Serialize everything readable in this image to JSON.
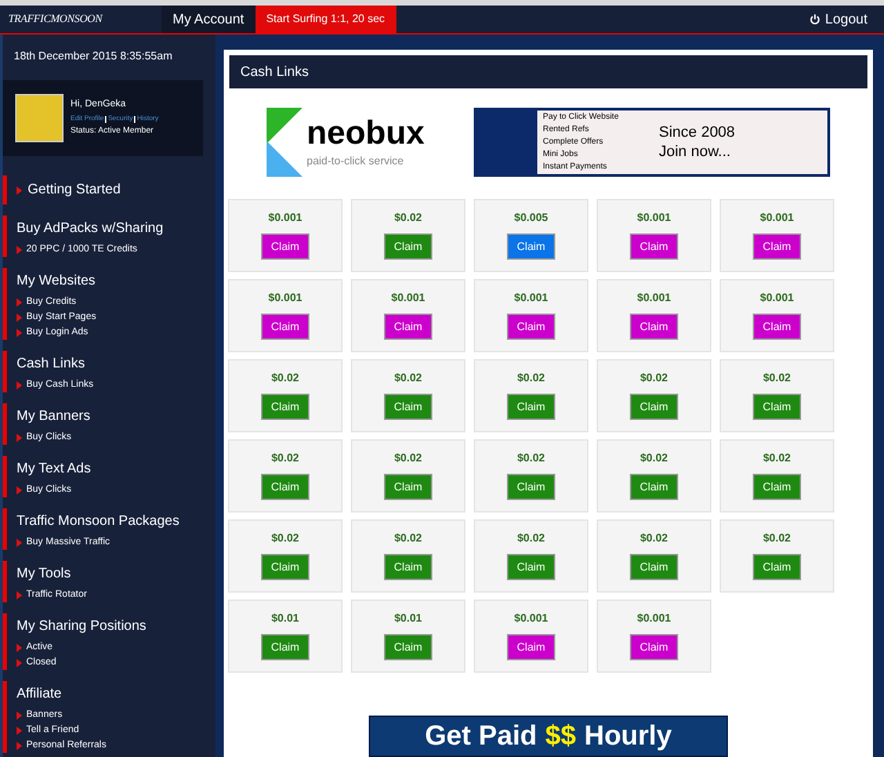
{
  "topbar": {
    "logo": "TRAFFICMONSOON",
    "tabs": [
      {
        "label": "My Account",
        "kind": "plain"
      },
      {
        "label": "Start Surfing 1:1, 20 sec",
        "kind": "alert"
      }
    ],
    "logout": "Logout"
  },
  "sidebar": {
    "datetime": "18th December 2015 8:35:55am",
    "profile": {
      "greeting": "Hi, DenGeka",
      "links": [
        "Edit Profile",
        "Security",
        "History"
      ],
      "status": "Status: Active Member"
    },
    "sections": [
      {
        "kind": "link",
        "title": "Getting Started"
      },
      {
        "kind": "group",
        "title": "Buy AdPacks w/Sharing",
        "links": [
          "20 PPC / 1000 TE Credits"
        ]
      },
      {
        "kind": "group",
        "title": "My Websites",
        "links": [
          "Buy Credits",
          "Buy Start Pages",
          "Buy Login Ads"
        ]
      },
      {
        "kind": "group",
        "title": "Cash Links",
        "links": [
          "Buy Cash Links"
        ]
      },
      {
        "kind": "group",
        "title": "My Banners",
        "links": [
          "Buy Clicks"
        ]
      },
      {
        "kind": "group",
        "title": "My Text Ads",
        "links": [
          "Buy Clicks"
        ]
      },
      {
        "kind": "group",
        "title": "Traffic Monsoon Packages",
        "links": [
          "Buy Massive Traffic"
        ]
      },
      {
        "kind": "group",
        "title": "My Tools",
        "links": [
          "Traffic Rotator"
        ]
      },
      {
        "kind": "group",
        "title": "My Sharing Positions",
        "links": [
          "Active",
          "Closed"
        ]
      },
      {
        "kind": "group",
        "title": "Affiliate",
        "links": [
          "Banners",
          "Tell a Friend",
          "Personal Referrals"
        ]
      }
    ]
  },
  "main": {
    "title": "Cash Links",
    "ad": {
      "brand": "neobux",
      "tagline": "paid-to-click service",
      "features": [
        "Pay to Click Website",
        "Rented Refs",
        "Complete Offers",
        "Mini Jobs",
        "Instant Payments"
      ],
      "slogan": [
        "Since 2008",
        "Join now..."
      ]
    },
    "cards": [
      {
        "amount": "$0.001",
        "button": "Claim",
        "color": "#cc00cc"
      },
      {
        "amount": "$0.02",
        "button": "Claim",
        "color": "#1f8a12"
      },
      {
        "amount": "$0.005",
        "button": "Claim",
        "color": "#0a74e8"
      },
      {
        "amount": "$0.001",
        "button": "Claim",
        "color": "#cc00cc"
      },
      {
        "amount": "$0.001",
        "button": "Claim",
        "color": "#cc00cc"
      },
      {
        "amount": "$0.001",
        "button": "Claim",
        "color": "#cc00cc"
      },
      {
        "amount": "$0.001",
        "button": "Claim",
        "color": "#cc00cc"
      },
      {
        "amount": "$0.001",
        "button": "Claim",
        "color": "#cc00cc"
      },
      {
        "amount": "$0.001",
        "button": "Claim",
        "color": "#cc00cc"
      },
      {
        "amount": "$0.001",
        "button": "Claim",
        "color": "#cc00cc"
      },
      {
        "amount": "$0.02",
        "button": "Claim",
        "color": "#1f8a12"
      },
      {
        "amount": "$0.02",
        "button": "Claim",
        "color": "#1f8a12"
      },
      {
        "amount": "$0.02",
        "button": "Claim",
        "color": "#1f8a12"
      },
      {
        "amount": "$0.02",
        "button": "Claim",
        "color": "#1f8a12"
      },
      {
        "amount": "$0.02",
        "button": "Claim",
        "color": "#1f8a12"
      },
      {
        "amount": "$0.02",
        "button": "Claim",
        "color": "#1f8a12"
      },
      {
        "amount": "$0.02",
        "button": "Claim",
        "color": "#1f8a12"
      },
      {
        "amount": "$0.02",
        "button": "Claim",
        "color": "#1f8a12"
      },
      {
        "amount": "$0.02",
        "button": "Claim",
        "color": "#1f8a12"
      },
      {
        "amount": "$0.02",
        "button": "Claim",
        "color": "#1f8a12"
      },
      {
        "amount": "$0.02",
        "button": "Claim",
        "color": "#1f8a12"
      },
      {
        "amount": "$0.02",
        "button": "Claim",
        "color": "#1f8a12"
      },
      {
        "amount": "$0.02",
        "button": "Claim",
        "color": "#1f8a12"
      },
      {
        "amount": "$0.02",
        "button": "Claim",
        "color": "#1f8a12"
      },
      {
        "amount": "$0.02",
        "button": "Claim",
        "color": "#1f8a12"
      },
      {
        "amount": "$0.01",
        "button": "Claim",
        "color": "#1f8a12"
      },
      {
        "amount": "$0.01",
        "button": "Claim",
        "color": "#1f8a12"
      },
      {
        "amount": "$0.001",
        "button": "Claim",
        "color": "#cc00cc"
      },
      {
        "amount": "$0.001",
        "button": "Claim",
        "color": "#cc00cc"
      }
    ],
    "bottom_banner": {
      "parts": [
        "Get Paid",
        "$$",
        "Hourly"
      ]
    }
  }
}
